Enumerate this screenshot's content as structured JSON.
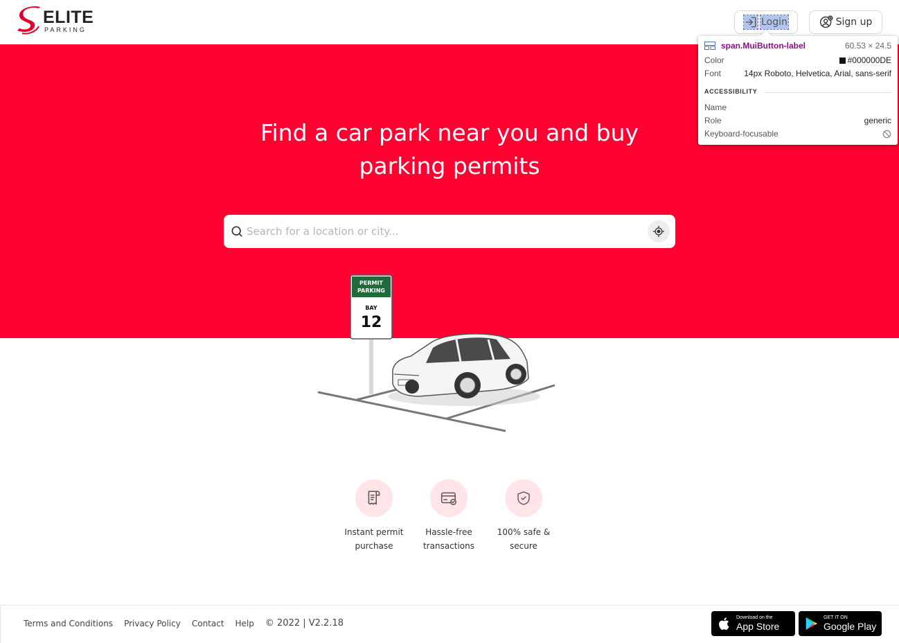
{
  "header": {
    "logo_brand": "ELITE",
    "logo_sub": "PARKING",
    "login_label": "Login",
    "signup_label": "Sign up"
  },
  "hero": {
    "title": "Find a car park near you and buy parking permits",
    "search_placeholder": "Search for a location or city...",
    "background": "#ff0030"
  },
  "illustration": {
    "sign_top_line1": "PERMIT",
    "sign_top_line2": "PARKING",
    "sign_bay": "BAY",
    "sign_number": "12"
  },
  "features": [
    {
      "label": "Instant permit purchase",
      "icon": "receipt-icon"
    },
    {
      "label": "Hassle-free transactions",
      "icon": "card-check-icon"
    },
    {
      "label": "100% safe & secure",
      "icon": "shield-check-icon"
    }
  ],
  "footer": {
    "links": [
      "Terms and Conditions",
      "Privacy Policy",
      "Contact",
      "Help"
    ],
    "copyright": "© 2022 | V2.2.18",
    "appstore_small": "Download on the",
    "appstore_big": "App Store",
    "googleplay_small": "GET IT ON",
    "googleplay_big": "Google Play"
  },
  "inspector": {
    "element": "span.MuiButton-label",
    "size": "60.53 × 24.5",
    "color_label": "Color",
    "color_value": "#000000DE",
    "font_label": "Font",
    "font_value": "14px Roboto, Helvetica, Arial, sans-serif",
    "section": "ACCESSIBILITY",
    "name_label": "Name",
    "name_value": "",
    "role_label": "Role",
    "role_value": "generic",
    "focus_label": "Keyboard-focusable"
  },
  "colors": {
    "brand_red": "#ff0030",
    "feature_circle": "#ffe4e8"
  }
}
